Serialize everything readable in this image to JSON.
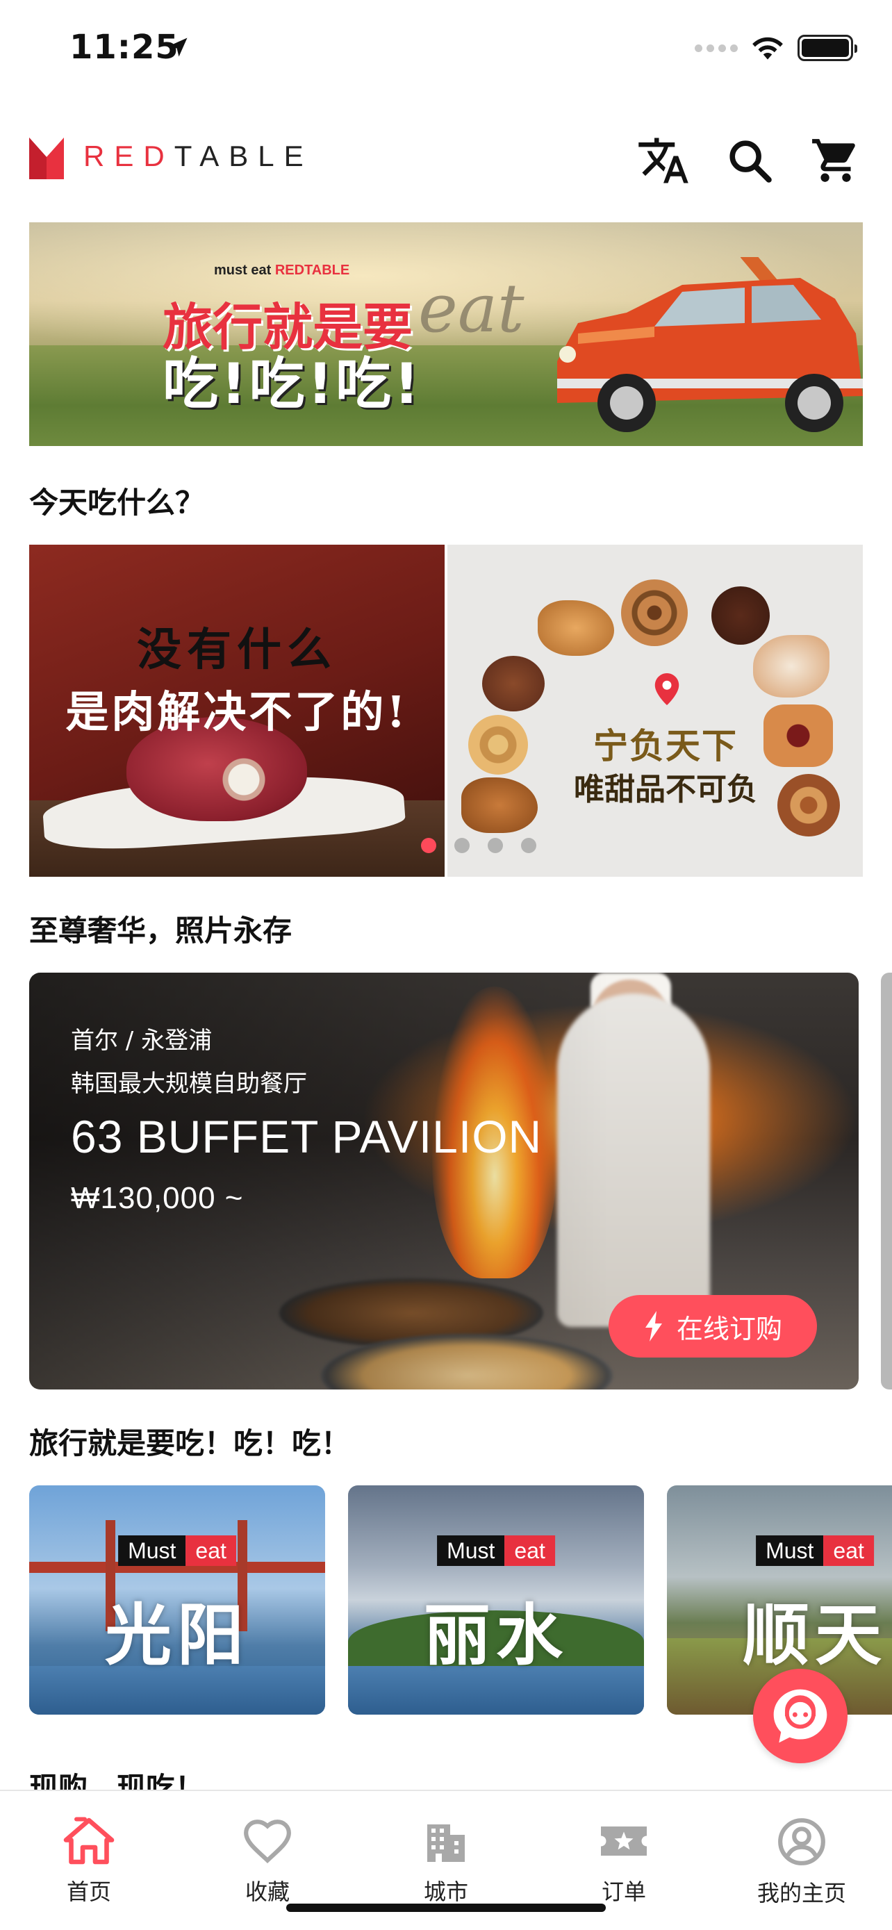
{
  "status_bar": {
    "time": "11:25"
  },
  "header": {
    "brand_red": "RED",
    "brand_black": "TABLE",
    "icons": [
      "translate-icon",
      "search-icon",
      "cart-icon"
    ]
  },
  "hero": {
    "small_prefix": "must eat ",
    "small_brand": "REDTABLE",
    "line1": "旅行就是要",
    "eat": "eat",
    "line2": "吃!吃!吃!"
  },
  "sections": {
    "today": "今天吃什么？",
    "luxury": "至尊奢华，照片永存",
    "travel": "旅行就是要吃！吃！吃！",
    "next": "现购，现吃！"
  },
  "promos": [
    {
      "line1": "没有什么",
      "line2": "是肉解决不了的!"
    },
    {
      "line1": "宁负天下",
      "line2": "唯甜品不可负"
    }
  ],
  "promo_dots": {
    "count": 4,
    "active": 0
  },
  "feature": {
    "location": "首尔 / 永登浦",
    "description": "韩国最大规模自助餐厅",
    "name": "63 BUFFET PAVILION",
    "price": "₩130,000 ~",
    "order_label": "在线订购"
  },
  "cities": [
    {
      "must": "Must",
      "eat": "eat",
      "name": "光阳"
    },
    {
      "must": "Must",
      "eat": "eat",
      "name": "丽水"
    },
    {
      "must": "Must",
      "eat": "eat",
      "name": "顺天"
    }
  ],
  "tabs": [
    {
      "label": "首页",
      "icon": "home-icon",
      "active": true
    },
    {
      "label": "收藏",
      "icon": "heart-icon",
      "active": false
    },
    {
      "label": "城市",
      "icon": "city-icon",
      "active": false
    },
    {
      "label": "订单",
      "icon": "ticket-icon",
      "active": false
    },
    {
      "label": "我的主页",
      "icon": "profile-icon",
      "active": false
    }
  ],
  "colors": {
    "accent": "#e8313f",
    "button": "#ff4f5c"
  }
}
